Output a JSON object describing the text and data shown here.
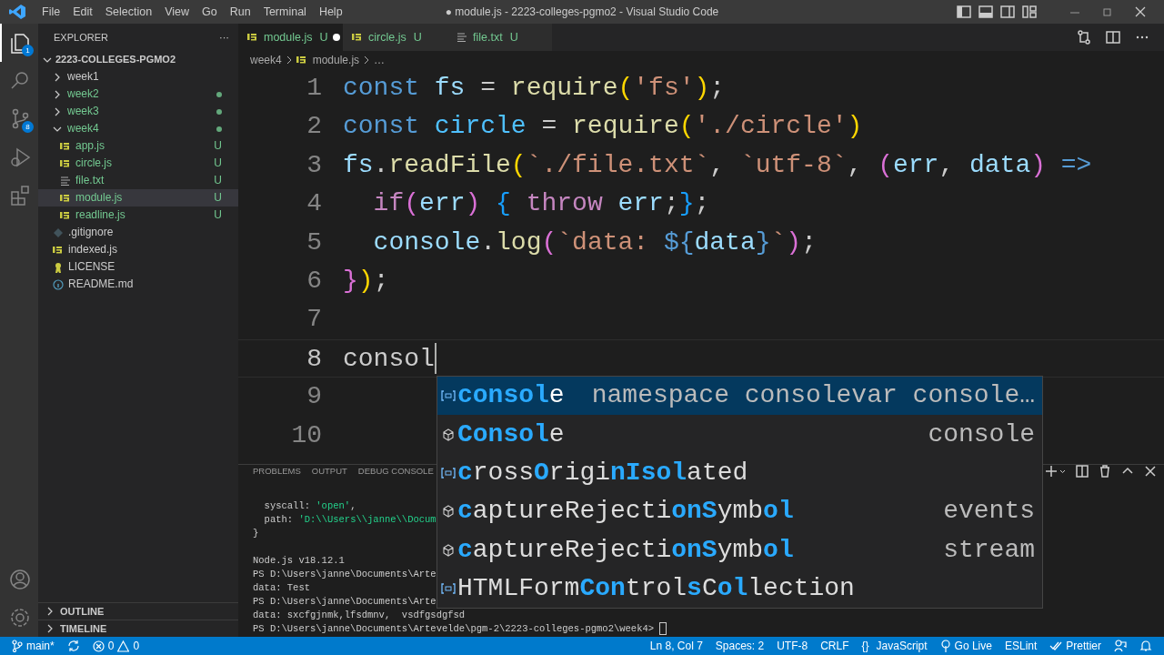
{
  "window": {
    "title": "● module.js - 2223-colleges-pgmo2 - Visual Studio Code"
  },
  "menu": [
    "File",
    "Edit",
    "Selection",
    "View",
    "Go",
    "Run",
    "Terminal",
    "Help"
  ],
  "activity_bar": [
    {
      "kind": "explorer",
      "badge": "1",
      "selected": true
    },
    {
      "kind": "search",
      "selected": false
    },
    {
      "kind": "source-control",
      "badge": "8",
      "selected": false
    },
    {
      "kind": "run",
      "selected": false
    },
    {
      "kind": "extensions",
      "selected": false
    }
  ],
  "sidebar": {
    "title": "EXPLORER",
    "more": "···",
    "root": {
      "label": "2223-COLLEGES-PGMO2",
      "expanded": true,
      "children": [
        {
          "label": "week1",
          "kind": "folder",
          "expanded": false,
          "changed": false,
          "selected": false
        },
        {
          "label": "week2",
          "kind": "folder",
          "expanded": false,
          "changed": true,
          "selected": false
        },
        {
          "label": "week3",
          "kind": "folder",
          "expanded": false,
          "changed": true,
          "selected": false
        },
        {
          "label": "week4",
          "kind": "folder",
          "expanded": true,
          "changed": true,
          "selected": false,
          "children": [
            {
              "label": "app.js",
              "kind": "js",
              "changed": true,
              "badge": "U",
              "selected": false
            },
            {
              "label": "circle.js",
              "kind": "js",
              "changed": true,
              "badge": "U",
              "selected": false
            },
            {
              "label": "file.txt",
              "kind": "txt",
              "changed": true,
              "badge": "U",
              "selected": false
            },
            {
              "label": "module.js",
              "kind": "js",
              "changed": true,
              "badge": "U",
              "selected": true
            },
            {
              "label": "readline.js",
              "kind": "js",
              "changed": true,
              "badge": "U",
              "selected": false
            }
          ]
        },
        {
          "label": ".gitignore",
          "kind": "git",
          "changed": false,
          "selected": false
        },
        {
          "label": "indexed.js",
          "kind": "js",
          "changed": false,
          "selected": false
        },
        {
          "label": "LICENSE",
          "kind": "license",
          "changed": false,
          "selected": false
        },
        {
          "label": "README.md",
          "kind": "info",
          "changed": false,
          "selected": false
        }
      ]
    },
    "sections": [
      {
        "label": "OUTLINE",
        "expanded": false
      },
      {
        "label": "TIMELINE",
        "expanded": false
      }
    ]
  },
  "tabs": [
    {
      "label": "module.js",
      "kind": "js",
      "badge": "U",
      "dirty": true,
      "selected": true
    },
    {
      "label": "circle.js",
      "kind": "js",
      "badge": "U",
      "dirty": false,
      "selected": false
    },
    {
      "label": "file.txt",
      "kind": "txt",
      "badge": "U",
      "dirty": false,
      "selected": false
    }
  ],
  "breadcrumb": [
    {
      "label": "week4",
      "kind": "folder"
    },
    {
      "label": "module.js",
      "kind": "js"
    },
    {
      "label": "…",
      "kind": "more"
    }
  ],
  "code": [
    {
      "number": "1",
      "current": false,
      "tokens": [
        {
          "text": "const",
          "kind": "keyword"
        },
        {
          "text": " fs",
          "kind": "variable"
        },
        {
          "text": " = "
        },
        {
          "text": "require",
          "kind": "function"
        },
        {
          "text": "(",
          "kind": "bracket1"
        },
        {
          "text": "'fs'",
          "kind": "string"
        },
        {
          "text": ")",
          "kind": "bracket1"
        },
        {
          "text": ";"
        }
      ]
    },
    {
      "number": "2",
      "current": false,
      "tokens": [
        {
          "text": "const",
          "kind": "keyword"
        },
        {
          "text": " circle",
          "kind": "constant"
        },
        {
          "text": " = "
        },
        {
          "text": "require",
          "kind": "function"
        },
        {
          "text": "(",
          "kind": "bracket1"
        },
        {
          "text": "'./circle'",
          "kind": "string"
        },
        {
          "text": ")",
          "kind": "bracket1"
        }
      ]
    },
    {
      "number": "3",
      "current": false,
      "tokens": [
        {
          "text": "fs",
          "kind": "variable"
        },
        {
          "text": "."
        },
        {
          "text": "readFile",
          "kind": "function"
        },
        {
          "text": "(",
          "kind": "bracket1"
        },
        {
          "text": "`./file.txt`",
          "kind": "string"
        },
        {
          "text": ", "
        },
        {
          "text": "`utf-8`",
          "kind": "string"
        },
        {
          "text": ", "
        },
        {
          "text": "(",
          "kind": "bracket2"
        },
        {
          "text": "err",
          "kind": "variable"
        },
        {
          "text": ", "
        },
        {
          "text": "data",
          "kind": "variable"
        },
        {
          "text": ")",
          "kind": "bracket2"
        },
        {
          "text": " =>",
          "kind": "keyword"
        }
      ]
    },
    {
      "number": "4",
      "current": false,
      "tokens": [
        {
          "text": "  if",
          "kind": "control"
        },
        {
          "text": "(",
          "kind": "bracket2"
        },
        {
          "text": "err",
          "kind": "variable"
        },
        {
          "text": ")",
          "kind": "bracket2"
        },
        {
          "text": " {",
          "kind": "bracket3"
        },
        {
          "text": " throw",
          "kind": "control"
        },
        {
          "text": " err",
          "kind": "variable"
        },
        {
          "text": ";"
        },
        {
          "text": "}",
          "kind": "bracket3"
        },
        {
          "text": ";"
        }
      ]
    },
    {
      "number": "5",
      "current": false,
      "tokens": [
        {
          "text": "  console",
          "kind": "variable"
        },
        {
          "text": "."
        },
        {
          "text": "log",
          "kind": "function"
        },
        {
          "text": "(",
          "kind": "bracket2"
        },
        {
          "text": "`data: ",
          "kind": "string"
        },
        {
          "text": "${",
          "kind": "keyword"
        },
        {
          "text": "data",
          "kind": "variable"
        },
        {
          "text": "}",
          "kind": "keyword"
        },
        {
          "text": "`",
          "kind": "string"
        },
        {
          "text": ")",
          "kind": "bracket2"
        },
        {
          "text": ";"
        }
      ]
    },
    {
      "number": "6",
      "current": false,
      "tokens": [
        {
          "text": "}",
          "kind": "bracket2"
        },
        {
          "text": ")",
          "kind": "bracket1"
        },
        {
          "text": ";"
        }
      ]
    },
    {
      "number": "7",
      "current": false
    },
    {
      "number": "8",
      "current": true,
      "tokens": [
        {
          "text": "consol"
        }
      ]
    },
    {
      "number": "9",
      "current": false
    },
    {
      "number": "10",
      "current": false
    }
  ],
  "suggestions": [
    {
      "label": "**consol**e",
      "detail": "namespace consolevar console…",
      "kind": "variable",
      "selected": true
    },
    {
      "label": "**Consol**e",
      "detail": "console",
      "kind": "module",
      "selected": false
    },
    {
      "label": "**c**ross**O**rigi**nIsol**ated",
      "kind": "variable",
      "selected": false
    },
    {
      "label": "**c**aptureRejecti**onS**ymb**ol**",
      "detail": "events",
      "kind": "module",
      "selected": false
    },
    {
      "label": "**c**aptureRejecti**onS**ymb**ol**",
      "detail": "stream",
      "kind": "module",
      "selected": false
    },
    {
      "label": "HTMLForm**Con**trol**s**C**ol**lection",
      "kind": "variable",
      "selected": false
    }
  ],
  "panel": {
    "tabs": [
      {
        "label": "PROBLEMS",
        "selected": false
      },
      {
        "label": "OUTPUT",
        "selected": false
      },
      {
        "label": "DEBUG CONSOLE",
        "selected": false
      }
    ],
    "terminal": [
      [
        {
          "text": "  syscall: "
        },
        {
          "text": "'open'",
          "kind": "string"
        },
        {
          "text": ","
        }
      ],
      [
        {
          "text": "  path: "
        },
        {
          "text": "'D:\\\\Users\\\\janne\\\\Docum",
          "kind": "string"
        }
      ],
      [
        {
          "text": "}"
        }
      ],
      [
        {
          "kind": "blank"
        }
      ],
      [
        {
          "text": "Node.js v18.12.1"
        }
      ],
      [
        {
          "text": "PS D:\\Users\\janne\\Documents\\Arte"
        }
      ],
      [
        {
          "text": "data: Test"
        }
      ],
      [
        {
          "text": "PS D:\\Users\\janne\\Documents\\Arte"
        }
      ],
      [
        {
          "text": "data: sxcfgjnmk,lfsdmnv,  vsdfgsdgfsd"
        }
      ],
      [
        {
          "text": "PS D:\\Users\\janne\\Documents\\Artevelde\\pgm-2\\2223-colleges-pgmo2\\week4> "
        },
        {
          "kind": "cursor"
        }
      ]
    ]
  },
  "status_bar": {
    "branch": "main*",
    "errors": "0",
    "warnings": "0",
    "right": [
      {
        "label": "Ln 8, Col 7"
      },
      {
        "label": "Spaces: 2"
      },
      {
        "label": "UTF-8"
      },
      {
        "label": "CRLF"
      },
      {
        "label": "JavaScript",
        "icon": "{}"
      },
      {
        "label": "Go Live",
        "kind": "broadcast"
      },
      {
        "label": "ESLint"
      },
      {
        "label": "Prettier",
        "kind": "checks"
      },
      {
        "kind": "feedback"
      },
      {
        "kind": "bell"
      }
    ]
  }
}
